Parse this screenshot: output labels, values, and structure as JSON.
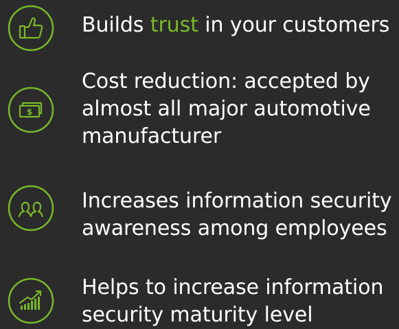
{
  "accent_color": "#7ab929",
  "text_color": "#ffffff",
  "background_color": "#2b2b2b",
  "benefits": [
    {
      "icon": "thumbs-up-icon",
      "before": "Builds ",
      "highlight": "trust",
      "after": " in your customers"
    },
    {
      "icon": "money-icon",
      "lines": [
        "Cost reduction: accepted by",
        "almost all major automotive",
        "manufacturer"
      ]
    },
    {
      "icon": "people-icon",
      "lines": [
        "Increases information security",
        "awareness among employees"
      ]
    },
    {
      "icon": "growth-chart-icon",
      "lines": [
        "Helps to increase information",
        "security maturity level"
      ]
    }
  ]
}
